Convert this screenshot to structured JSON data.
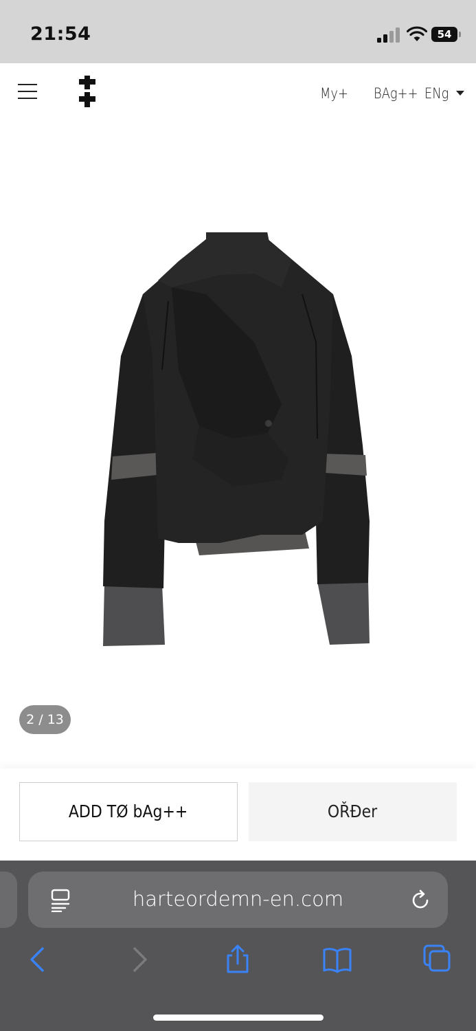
{
  "status_bar": {
    "time": "21:54",
    "battery_level": "54",
    "icons": [
      "signal-icon",
      "wifi-icon",
      "battery-icon"
    ]
  },
  "header": {
    "menu_icon": "hamburger-menu-icon",
    "logo_icon": "double-cross-logo",
    "nav": {
      "my_label": "My+",
      "bag_label": "BAg++",
      "lang_label": "ENg"
    }
  },
  "product": {
    "image_subject": "black-draped-jacket",
    "pager": "2 / 13"
  },
  "actions": {
    "add_to_bag_label": "ADD TØ bAg++",
    "order_label": "OŘĐer"
  },
  "browser": {
    "url": "harteordemn-en.com",
    "toolbar": [
      "back-icon",
      "forward-icon",
      "share-icon",
      "bookmarks-icon",
      "tabs-icon"
    ]
  },
  "colors": {
    "status_bar_bg": "#d5d5d5",
    "browser_bg": "#555557",
    "link_blue": "#3a82f7",
    "pager_bg": "#8d8d8d",
    "order_bg": "#f4f4f4"
  }
}
